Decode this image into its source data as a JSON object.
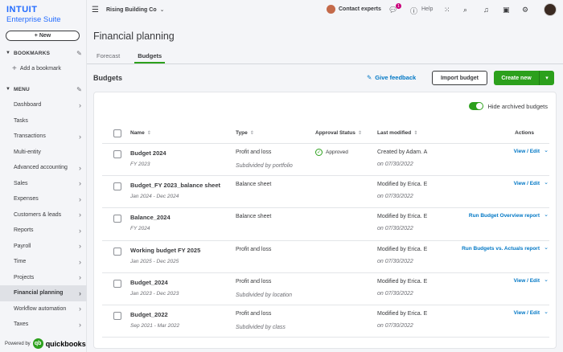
{
  "brand": {
    "line1": "INTUIT",
    "line2": "Enterprise Suite"
  },
  "sidebar": {
    "new_label": "+ New",
    "bookmarks_label": "BOOKMARKS",
    "add_bookmark_label": "Add a bookmark",
    "menu_label": "MENU",
    "items": [
      {
        "label": "Dashboard",
        "chevron": true
      },
      {
        "label": "Tasks",
        "chevron": false
      },
      {
        "label": "Transactions",
        "chevron": true
      },
      {
        "label": "Multi-entity",
        "chevron": false
      },
      {
        "label": "Advanced accounting",
        "chevron": true
      },
      {
        "label": "Sales",
        "chevron": true
      },
      {
        "label": "Expenses",
        "chevron": true
      },
      {
        "label": "Customers & leads",
        "chevron": true
      },
      {
        "label": "Reports",
        "chevron": true
      },
      {
        "label": "Payroll",
        "chevron": true
      },
      {
        "label": "Time",
        "chevron": true
      },
      {
        "label": "Projects",
        "chevron": true
      },
      {
        "label": "Financial planning",
        "chevron": true,
        "active": true
      },
      {
        "label": "Workflow automation",
        "chevron": true
      },
      {
        "label": "Taxes",
        "chevron": true
      }
    ],
    "powered_by": "Powered by",
    "qb_name": "quickbooks"
  },
  "topbar": {
    "company": "Rising Building Co",
    "contact": "Contact experts",
    "notification_count": "1",
    "help": "Help"
  },
  "page": {
    "title": "Financial planning",
    "tabs": [
      {
        "label": "Forecast",
        "active": false
      },
      {
        "label": "Budgets",
        "active": true
      }
    ],
    "section_title": "Budgets",
    "feedback": "Give feedback",
    "import_label": "Import budget",
    "create_label": "Create new",
    "hide_archived": "Hide archived budgets"
  },
  "table": {
    "headers": {
      "name": "Name",
      "type": "Type",
      "approval": "Approval Status",
      "modified": "Last modified",
      "actions": "Actions"
    },
    "rows": [
      {
        "name": "Budget 2024",
        "period": "FY 2023",
        "type": "Profit and loss",
        "type_sub": "Subdivided by portfolio",
        "approval": "Approved",
        "modified_by": "Created by Adam. A",
        "modified_on": "on 07/30/2022",
        "action": "View / Edit"
      },
      {
        "name": "Budget_FY 2023_balance sheet",
        "period": "Jan 2024 - Dec 2024",
        "type": "Balance sheet",
        "type_sub": "",
        "approval": "",
        "modified_by": "Modified by Erica. E",
        "modified_on": "on 07/30/2022",
        "action": "View / Edit"
      },
      {
        "name": "Balance_2024",
        "period": "FY 2024",
        "type": "Balance sheet",
        "type_sub": "",
        "approval": "",
        "modified_by": "Modified by Erica. E",
        "modified_on": "on 07/30/2022",
        "action": "Run Budget Overview report"
      },
      {
        "name": "Working budget  FY 2025",
        "period": "Jan 2025 - Dec 2025",
        "type": "Profit and loss",
        "type_sub": "",
        "approval": "",
        "modified_by": "Modified by Erica. E",
        "modified_on": "on 07/30/2022",
        "action": "Run Budgets vs. Actuals report"
      },
      {
        "name": "Budget_2024",
        "period": "Jan 2023 - Dec 2023",
        "type": "Profit and loss",
        "type_sub": "Subdivided by location",
        "approval": "",
        "modified_by": "Modified by Erica. E",
        "modified_on": "on 07/30/2022",
        "action": "View / Edit"
      },
      {
        "name": "Budget_2022",
        "period": "Sep 2021 - Mar 2022",
        "type": "Profit and loss",
        "type_sub": "Subdivided by class",
        "approval": "",
        "modified_by": "Modified by Erica. E",
        "modified_on": "on 07/30/2022",
        "action": "View / Edit"
      }
    ]
  },
  "colors": {
    "brand_green": "#2ca01c",
    "link_blue": "#0077c5",
    "intuit_blue": "#236cff"
  },
  "icons": [
    "hamburger-icon",
    "chevron-down-icon",
    "chat-icon",
    "help-icon",
    "apps-grid-icon",
    "search-icon",
    "bell-icon",
    "clipboard-icon",
    "gear-icon",
    "pencil-icon",
    "feedback-icon",
    "check-circle-icon",
    "sort-icon"
  ]
}
